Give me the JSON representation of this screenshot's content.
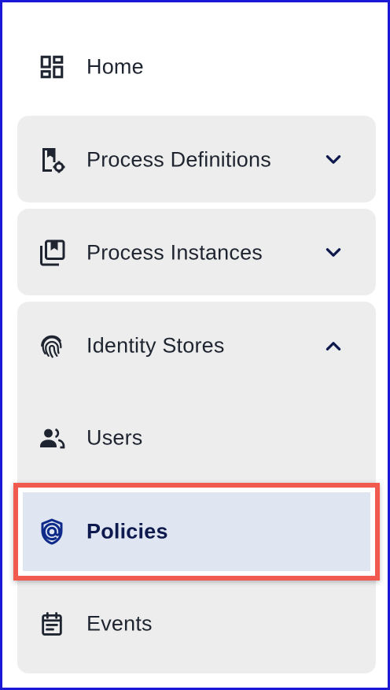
{
  "nav": {
    "home": {
      "label": "Home",
      "icon": "dashboard-icon"
    },
    "process_definitions": {
      "label": "Process Definitions",
      "icon": "process-definitions-icon",
      "chevron": "chevron-down-icon"
    },
    "process_instances": {
      "label": "Process Instances",
      "icon": "process-instances-icon",
      "chevron": "chevron-down-icon"
    },
    "identity_stores": {
      "label": "Identity Stores",
      "icon": "fingerprint-icon",
      "chevron": "chevron-up-icon",
      "children": [
        {
          "label": "Users",
          "icon": "users-icon"
        },
        {
          "label": "Policies",
          "icon": "shield-icon",
          "active": true
        },
        {
          "label": "Events",
          "icon": "calendar-icon"
        }
      ]
    }
  },
  "colors": {
    "frame_border": "#1a17d6",
    "group_background": "#ededed",
    "active_background": "#dfe6f2",
    "active_highlight_border": "#f05a4f",
    "active_text": "#0e1a4d",
    "text": "#1f2530"
  }
}
